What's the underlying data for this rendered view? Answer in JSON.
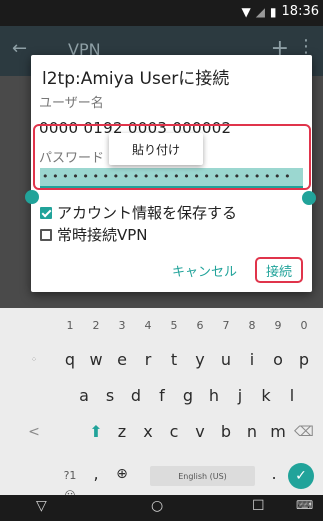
{
  "status_bar": {
    "time": "18:36",
    "icons": [
      "wifi-icon",
      "signal-icon",
      "battery-icon"
    ]
  },
  "app_bar": {
    "title": "VPN",
    "icons": [
      "back-arrow-icon",
      "add-icon",
      "more-vert-icon"
    ]
  },
  "dialog": {
    "title": "l2tp:Amiya Userに接続",
    "username_label": "ユーザー名",
    "username_value": "0000 0192 0003 000002",
    "password_label": "パスワード",
    "paste_label": "貼り付け",
    "password_dots": "•••••••••••••••••••••••••",
    "save_account_label": "アカウント情報を保存する",
    "save_account_checked": true,
    "always_on_label": "常時接続VPN",
    "always_on_checked": false,
    "cancel_label": "キャンセル",
    "connect_label": "接続"
  },
  "keyboard": {
    "numbers": [
      "1",
      "2",
      "3",
      "4",
      "5",
      "6",
      "7",
      "8",
      "9",
      "0"
    ],
    "row1": [
      "q",
      "w",
      "e",
      "r",
      "t",
      "y",
      "u",
      "i",
      "o",
      "p"
    ],
    "row2": [
      "a",
      "s",
      "d",
      "f",
      "g",
      "h",
      "j",
      "k",
      "l"
    ],
    "row3": [
      "z",
      "x",
      "c",
      "v",
      "b",
      "n",
      "m"
    ],
    "symbols_label": "?1☺",
    "comma": ",",
    "globe": "⊕",
    "space_label": "English (US)",
    "period": ".",
    "accent_color": "#21a39a"
  },
  "nav_bar": {
    "icons": [
      "back-triangle-icon",
      "home-circle-icon",
      "recents-square-icon",
      "keyboard-switch-icon"
    ]
  },
  "colors": {
    "highlight_red": "#e0344b",
    "teal": "#21a39a",
    "appbar": "#2c3a40"
  }
}
